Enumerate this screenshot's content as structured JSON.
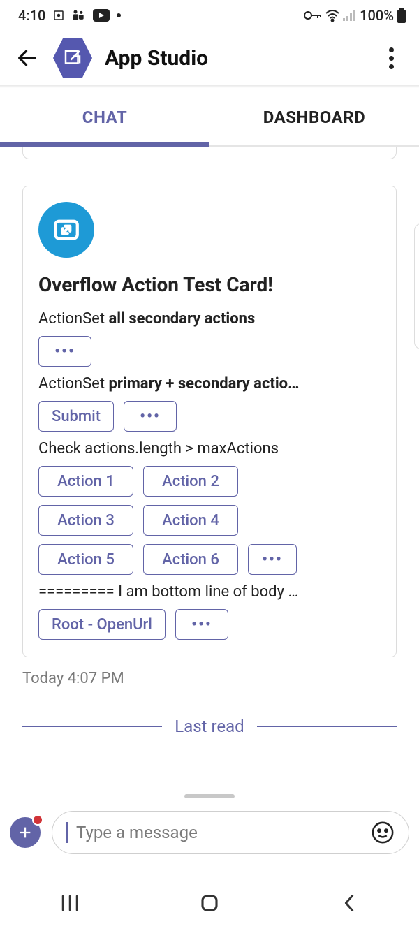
{
  "status": {
    "time": "4:10",
    "battery": "100%"
  },
  "app": {
    "title": "App Studio"
  },
  "tabs": {
    "chat": "CHAT",
    "dashboard": "DASHBOARD"
  },
  "card": {
    "title": "Overflow Action Test Card!",
    "set1_prefix": "ActionSet ",
    "set1_bold": "all secondary actions",
    "overflow": "•••",
    "set2_prefix": "ActionSet ",
    "set2_bold": "primary + secondary actio…",
    "submit": "Submit",
    "set3": "Check actions.length > maxActions",
    "a1": "Action 1",
    "a2": "Action 2",
    "a3": "Action 3",
    "a4": "Action 4",
    "a5": "Action 5",
    "a6": "Action 6",
    "bottom": "========= I am bottom line of body …",
    "root_btn": "Root - OpenUrl"
  },
  "timestamp": "Today 4:07 PM",
  "last_read": "Last read",
  "composer": {
    "placeholder": "Type a message"
  }
}
